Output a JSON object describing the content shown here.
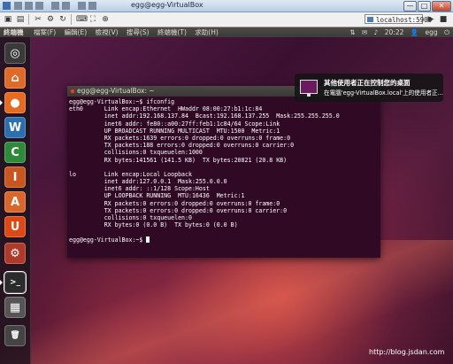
{
  "vnc": {
    "window_title": "egg@egg-VirtualBox",
    "host": "localhost:5900",
    "window_buttons": [
      "—",
      "□",
      "✕"
    ]
  },
  "panel": {
    "app_name": "終端機",
    "menu": [
      "檔案(F)",
      "編輯(E)",
      "檢視(V)",
      "搜尋(S)",
      "終端機(T)",
      "求助(H)"
    ],
    "time": "20:22",
    "user": "egg"
  },
  "launcher": {
    "items": [
      {
        "name": "dash-home",
        "glyph": "◎",
        "color": "#3a3a3a"
      },
      {
        "name": "files-home",
        "glyph": "⌂",
        "color": "#e06a2a"
      },
      {
        "name": "firefox",
        "glyph": "●",
        "color": "#e66a1f"
      },
      {
        "name": "writer",
        "glyph": "W",
        "color": "#2b6fb0"
      },
      {
        "name": "calc",
        "glyph": "C",
        "color": "#2e8a3a"
      },
      {
        "name": "impress",
        "glyph": "I",
        "color": "#c8561e"
      },
      {
        "name": "software-center",
        "glyph": "A",
        "color": "#d9672b"
      },
      {
        "name": "ubuntu-one",
        "glyph": "U",
        "color": "#dd4814"
      },
      {
        "name": "system-settings",
        "glyph": "⚙",
        "color": "#b03a2a"
      },
      {
        "name": "terminal",
        "glyph": ">_",
        "color": "#2b2b2b"
      },
      {
        "name": "workspaces",
        "glyph": "▦",
        "color": "#555555"
      },
      {
        "name": "trash",
        "glyph": "🗑",
        "color": "#444444"
      }
    ]
  },
  "terminal": {
    "title": "egg@egg-VirtualBox: ~",
    "lines": [
      "egg@egg-VirtualBox:~$ ifconfig",
      "eth0      Link encap:Ethernet  HWaddr 08:00:27:b1:1c:84",
      "          inet addr:192.168.137.84  Bcast:192.168.137.255  Mask:255.255.255.0",
      "          inet6 addr: fe80::a00:27ff:feb1:1c84/64 Scope:Link",
      "          UP BROADCAST RUNNING MULTICAST  MTU:1500  Metric:1",
      "          RX packets:1639 errors:0 dropped:0 overruns:0 frame:0",
      "          TX packets:188 errors:0 dropped:0 overruns:0 carrier:0",
      "          collisions:0 txqueuelen:1000",
      "          RX bytes:141561 (141.5 KB)  TX bytes:20821 (20.8 KB)",
      "",
      "lo        Link encap:Local Loopback",
      "          inet addr:127.0.0.1  Mask:255.0.0.0",
      "          inet6 addr: ::1/128 Scope:Host",
      "          UP LOOPBACK RUNNING  MTU:16436  Metric:1",
      "          RX packets:0 errors:0 dropped:0 overruns:0 frame:0",
      "          TX packets:0 errors:0 dropped:0 overruns:0 carrier:0",
      "          collisions:0 txqueuelen:0",
      "          RX bytes:0 (0.0 B)  TX bytes:0 (0.0 B)",
      ""
    ],
    "prompt": "egg@egg-VirtualBox:~$ "
  },
  "notification": {
    "title": "其他使用者正在控制您的桌面",
    "body": "在電腦'egg-VirtualBox.local'上的使用者正..."
  },
  "watermark": "http://blog.jsdan.com"
}
